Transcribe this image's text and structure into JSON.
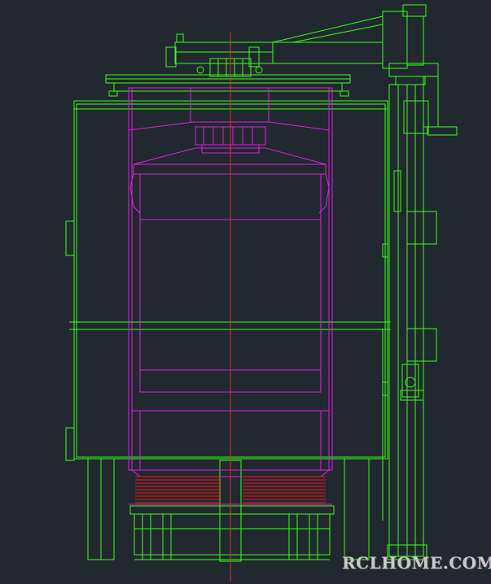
{
  "watermark": {
    "text": "RCLHOME.COM"
  },
  "colors": {
    "background": "#212830",
    "frame_lines": "#39ff14",
    "vessel_lines": "#e020e0",
    "heating_coils": "#ff1010",
    "centerline": "#ff2020"
  }
}
